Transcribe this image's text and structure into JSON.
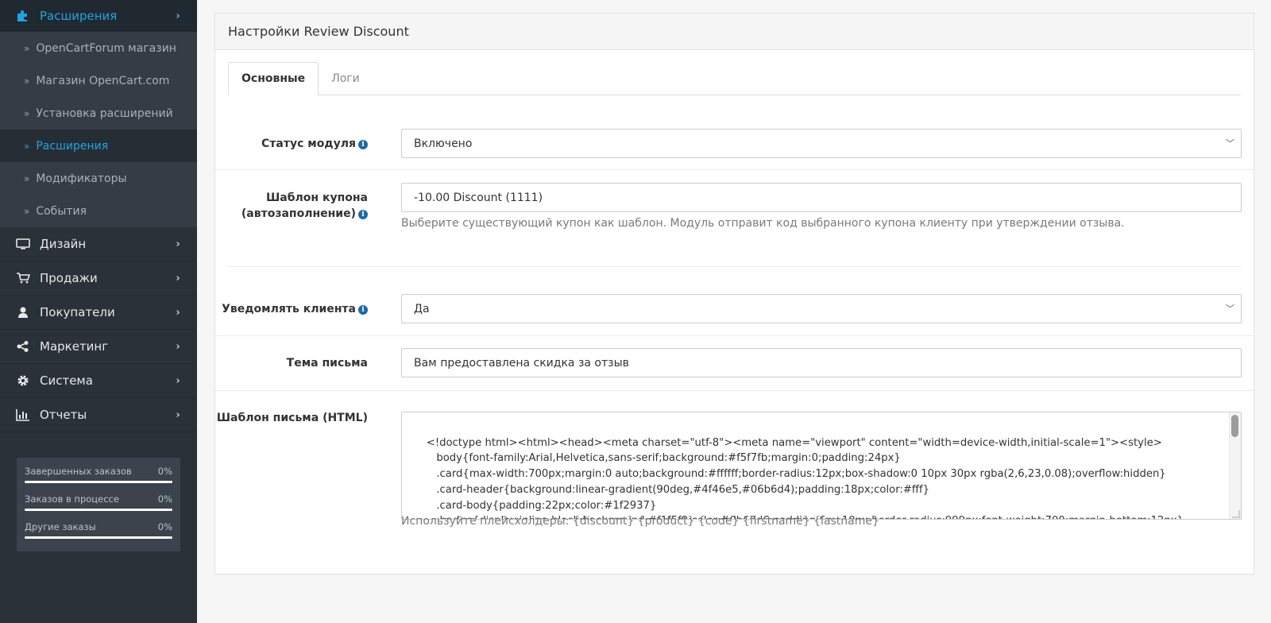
{
  "sidebar": {
    "top": {
      "label": "Расширения",
      "icon": "puzzle-icon"
    },
    "sub_items": [
      {
        "label": "OpenCartForum магазин",
        "active": false
      },
      {
        "label": "Магазин OpenCart.com",
        "active": false
      },
      {
        "label": "Установка расширений",
        "active": false
      },
      {
        "label": "Расширения",
        "active": true
      },
      {
        "label": "Модификаторы",
        "active": false
      },
      {
        "label": "События",
        "active": false
      }
    ],
    "items": [
      {
        "label": "Дизайн",
        "icon": "monitor-icon"
      },
      {
        "label": "Продажи",
        "icon": "cart-icon"
      },
      {
        "label": "Покупатели",
        "icon": "user-icon"
      },
      {
        "label": "Маркетинг",
        "icon": "share-icon"
      },
      {
        "label": "Система",
        "icon": "gear-icon"
      },
      {
        "label": "Отчеты",
        "icon": "bar-chart-icon"
      }
    ],
    "stats": [
      {
        "label": "Завершенных заказов",
        "value": "0%",
        "progress": 0
      },
      {
        "label": "Заказов в процессе",
        "value": "0%",
        "progress": 0
      },
      {
        "label": "Другие заказы",
        "value": "0%",
        "progress": 0
      }
    ]
  },
  "panel": {
    "title": "Настройки Review Discount",
    "tabs": [
      {
        "label": "Основные",
        "active": true
      },
      {
        "label": "Логи",
        "active": false
      }
    ],
    "fields": {
      "status": {
        "label": "Статус модуля",
        "value": "Включено"
      },
      "coupon": {
        "label_line1": "Шаблон купона",
        "label_line2": "(автозаполнение)",
        "value": "-10.00 Discount (1111)",
        "help": "Выберите существующий купон как шаблон. Модуль отправит код выбранного купона клиенту при утверждении отзыва."
      },
      "notify": {
        "label": "Уведомлять клиента",
        "value": "Да"
      },
      "subject": {
        "label": "Тема письма",
        "value": "Вам предоставлена скидка за отзыв"
      },
      "template": {
        "label": "Шаблон письма (HTML)",
        "value": "<!doctype html><html><head><meta charset=\"utf-8\"><meta name=\"viewport\" content=\"width=device-width,initial-scale=1\"><style>\n       body{font-family:Arial,Helvetica,sans-serif;background:#f5f7fb;margin:0;padding:24px}\n       .card{max-width:700px;margin:0 auto;background:#ffffff;border-radius:12px;box-shadow:0 10px 30px rgba(2,6,23,0.08);overflow:hidden}\n       .card-header{background:linear-gradient(90deg,#4f46e5,#06b6d4);padding:18px;color:#fff}\n       .card-body{padding:22px;color:#1f2937}\n       .badge{display:inline-block;background:#f1f5f9;color:#0b63d6;padding:6px 10px;border-radius:999px;font-weight:700;margin-bottom:12px}\n       .code{display:inline-block;background:#f8fafc;border:1px dashed #c2c8f0;padding:10px 14px;border-radius:8px;font-family:monospace;margin",
        "help": "Используйте плейсхолдеры: {discount} {product} {code} {firstname} {lastname}"
      }
    }
  }
}
